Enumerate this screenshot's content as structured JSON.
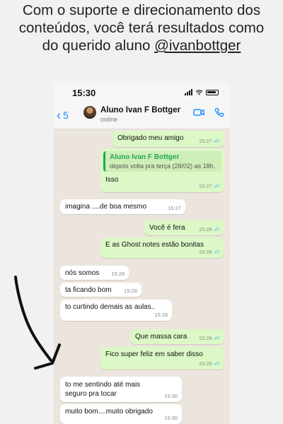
{
  "caption": {
    "line1": "Com o suporte e direcionamento dos",
    "line2": "conteúdos, você terá resultados como",
    "line3_prefix": "do querido aluno ",
    "handle": "@ivanbottger"
  },
  "status_bar": {
    "time": "15:30"
  },
  "header": {
    "back_count": "5",
    "contact_name": "Aluno Ivan F Bottger",
    "contact_status": "online"
  },
  "messages": [
    {
      "dir": "out",
      "text": "Obrigado meu amigo",
      "time": "15:27",
      "read": true
    },
    {
      "dir": "out",
      "quote_name": "Aluno Ivan F Bottger",
      "quote_text": "depois volta pra terça (28/02) as 18h,",
      "text": "Isso",
      "time": "15:27",
      "read": true
    },
    {
      "dir": "in",
      "text": "imagina ....de boa mesmo",
      "time": "15:27"
    },
    {
      "dir": "out",
      "text": "Você é fera",
      "time": "15:28",
      "read": true
    },
    {
      "dir": "out",
      "text": "E as Ghost notes estão bonitas",
      "time": "15:28",
      "read": true
    },
    {
      "dir": "in",
      "text": "nós somos",
      "time": "15:28"
    },
    {
      "dir": "in",
      "text": "ta ficando bom",
      "time": "15:28"
    },
    {
      "dir": "in",
      "text": "to curtindo demais as aulas..",
      "time": "15:28"
    },
    {
      "dir": "out",
      "text": "Que massa cara",
      "time": "15:29",
      "read": true
    },
    {
      "dir": "out",
      "text": "Fico super feliz em saber disso",
      "time": "15:29",
      "read": true
    },
    {
      "dir": "in",
      "text": "to me sentindo até mais seguro pra tocar",
      "time": "15:30"
    },
    {
      "dir": "in",
      "text": "muito bom....muito obrigado",
      "time": "15:30"
    }
  ],
  "colors": {
    "outgoing": "#dcf8c6",
    "incoming": "#ffffff",
    "accent": "#1a8cff",
    "read_ticks": "#34b7f1",
    "quote_bar": "#1fa855"
  },
  "icons": [
    "chevron-left-icon",
    "video-call-icon",
    "phone-icon",
    "signal-icon",
    "wifi-icon",
    "battery-icon",
    "double-check-icon"
  ]
}
